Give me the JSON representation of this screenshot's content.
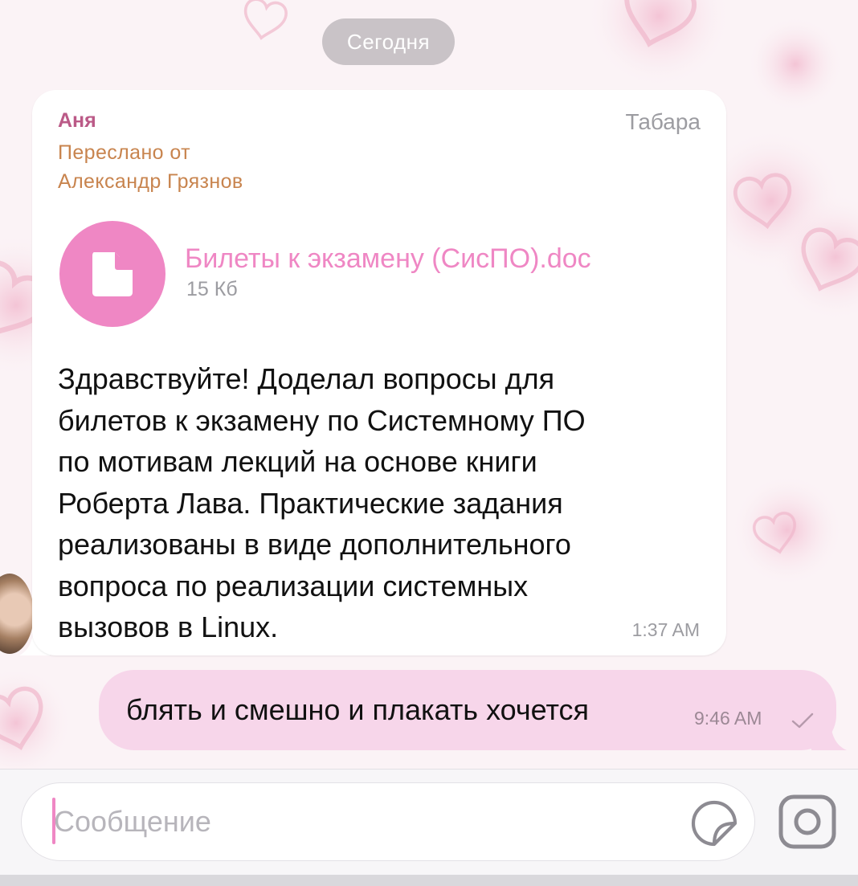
{
  "date_separator": "Сегодня",
  "incoming_message": {
    "sender": "Аня",
    "group": "Табара",
    "forwarded_label": "Переслано от",
    "forwarded_from": "Александр Грязнов",
    "file": {
      "name": "Билеты к экзамену (СисПО).doc",
      "size": "15 Кб",
      "icon": "document-icon"
    },
    "text_lines": [
      "Здравствуйте! Доделал вопросы для",
      "билетов к экзамену по Системному ПО",
      "по мотивам лекций на основе книги",
      "Роберта Лава. Практические задания",
      "реализованы в виде дополнительного",
      "вопроса по реализации системных",
      "вызовов в Linux."
    ],
    "time": "1:37 AM"
  },
  "outgoing_message": {
    "text": "блять и смешно и плакать хочется",
    "time": "9:46 AM",
    "status_icon": "checkmark-icon"
  },
  "composer": {
    "placeholder": "Сообщение",
    "sticker_icon": "sticker-icon",
    "camera_icon": "camera-icon"
  },
  "colors": {
    "accent_pink": "#ef87c4",
    "sender_name": "#bb5a87",
    "forwarded": "#c8844e",
    "outgoing_bubble": "#f7d6ea"
  }
}
